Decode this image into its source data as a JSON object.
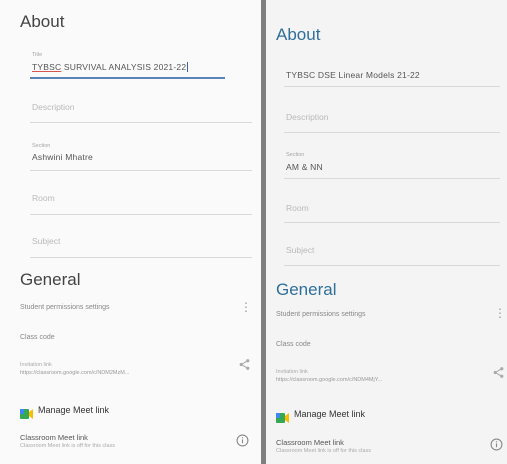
{
  "left": {
    "about_title": "About",
    "title_label": "Title",
    "title_value_prefix": "TYBSC",
    "title_value_rest": " SURVIVAL ANALYSIS 2021-22",
    "description_placeholder": "Description",
    "section_label": "Section",
    "section_value": "Ashwini Mhatre",
    "room_placeholder": "Room",
    "subject_placeholder": "Subject",
    "general_title": "General",
    "student_permissions": "Student permissions settings",
    "class_code": "Class code",
    "invitation_link_label": "Invitation link",
    "invitation_link_url": "https://classroom.google.com/c/NDM2MzM...",
    "manage_meet_label": "Manage Meet link",
    "classroom_meet_label": "Classroom Meet link",
    "classroom_meet_sub": "Classroom Meet link is off for this class"
  },
  "right": {
    "about_title": "About",
    "title_value": "TYBSC DSE  Linear Models 21-22",
    "description_placeholder": "Description",
    "section_label": "Section",
    "section_value": "AM & NN",
    "room_placeholder": "Room",
    "subject_placeholder": "Subject",
    "general_title": "General",
    "student_permissions": "Student permissions settings",
    "class_code": "Class code",
    "invitation_link_label": "Invitation link",
    "invitation_link_url": "https://classroom.google.com/c/NDM4MjY...",
    "manage_meet_label": "Manage Meet link",
    "classroom_meet_label": "Classroom Meet link",
    "classroom_meet_sub": "Classroom Meet link is off for this class"
  },
  "colors": {
    "accent_blue": "#2f6f9a",
    "focus_line": "#5b83b8",
    "divider": "#7f7f7f"
  },
  "icons": [
    "more-vert-icon",
    "share-icon",
    "info-icon",
    "google-meet-icon"
  ]
}
